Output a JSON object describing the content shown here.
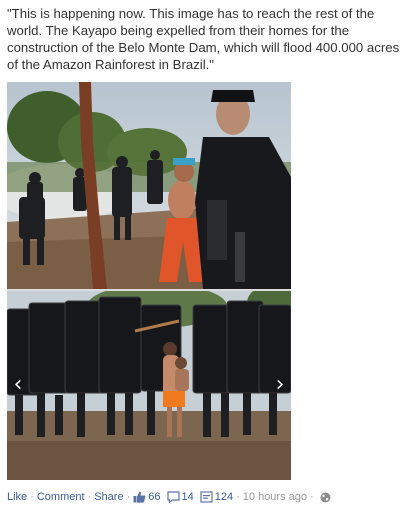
{
  "post": {
    "caption": "\"This is happening now. This image has to reach the rest of the world. The Kayapo being expelled from their homes for the construction of the Belo Monte Dam, which will flood 400.000 acres of the Amazon Rainforest in Brazil.\""
  },
  "photo": {
    "prev_arrow": "‹",
    "next_arrow": "›"
  },
  "footer": {
    "like": "Like",
    "comment": "Comment",
    "share": "Share",
    "separator": "·",
    "likes_count": "66",
    "comments_count": "14",
    "shares_count": "124",
    "timestamp": "10 hours ago",
    "icons": {
      "likes": "thumbs-up-icon",
      "comments": "speech-bubble-icon",
      "shares": "share-icon",
      "audience": "globe-icon"
    }
  },
  "colors": {
    "link": "#3b5998",
    "meta": "#7f7f7f",
    "text": "#333333"
  }
}
